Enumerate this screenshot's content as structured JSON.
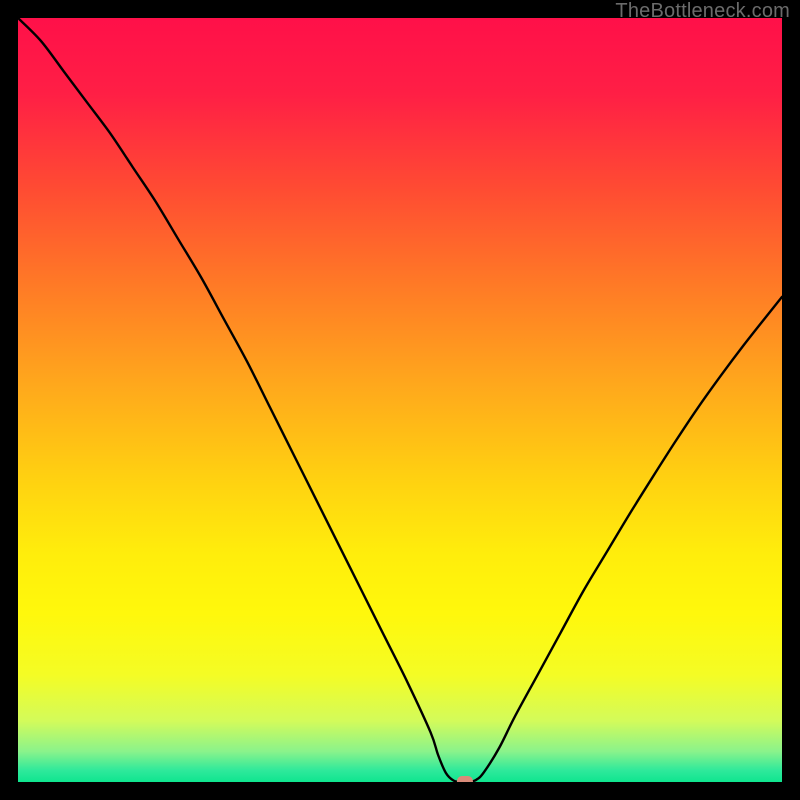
{
  "watermark": "TheBottleneck.com",
  "chart_data": {
    "type": "line",
    "title": "",
    "xlabel": "",
    "ylabel": "",
    "xlim": [
      0,
      100
    ],
    "ylim": [
      0,
      100
    ],
    "x": [
      0,
      3,
      6,
      9,
      12,
      15,
      18,
      21,
      24,
      27,
      30,
      33,
      36,
      39,
      42,
      45,
      48,
      51,
      54,
      55,
      56,
      57,
      58,
      59,
      60,
      61,
      63,
      65,
      68,
      71,
      74,
      77,
      80,
      83,
      86,
      89,
      92,
      95,
      98,
      100
    ],
    "values": [
      100,
      97,
      93,
      89,
      85,
      80.5,
      76,
      71,
      66,
      60.5,
      55,
      49,
      43,
      37,
      31,
      25,
      19,
      13,
      6.5,
      3.5,
      1.2,
      0.2,
      0,
      0,
      0.3,
      1.3,
      4.5,
      8.5,
      14,
      19.5,
      25,
      30,
      35,
      39.8,
      44.5,
      49,
      53.2,
      57.2,
      61,
      63.5
    ],
    "marker": {
      "x": 58.5,
      "y": 0
    },
    "gradient_stops": [
      {
        "pos": 0.0,
        "color": "#ff1049"
      },
      {
        "pos": 0.1,
        "color": "#ff1f45"
      },
      {
        "pos": 0.22,
        "color": "#ff4a33"
      },
      {
        "pos": 0.35,
        "color": "#ff7a26"
      },
      {
        "pos": 0.48,
        "color": "#ffa81c"
      },
      {
        "pos": 0.6,
        "color": "#ffd011"
      },
      {
        "pos": 0.7,
        "color": "#ffed0c"
      },
      {
        "pos": 0.78,
        "color": "#fff80c"
      },
      {
        "pos": 0.86,
        "color": "#f4fc25"
      },
      {
        "pos": 0.92,
        "color": "#d3fb5a"
      },
      {
        "pos": 0.96,
        "color": "#8af38b"
      },
      {
        "pos": 0.985,
        "color": "#2ee99b"
      },
      {
        "pos": 1.0,
        "color": "#0fe58f"
      }
    ]
  }
}
